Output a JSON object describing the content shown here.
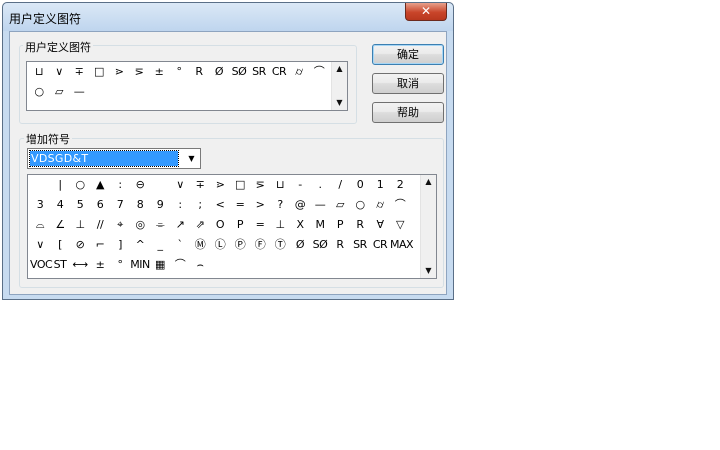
{
  "window": {
    "title": "用户定义图符",
    "close_label": "✕"
  },
  "user_defined_group": {
    "label": "用户定义图符",
    "symbols": [
      "⊔",
      "∨",
      "∓",
      "□",
      "⋗",
      "⋝",
      "±",
      "°",
      "R",
      "Ø",
      "SØ",
      "SR",
      "CR",
      "⌭",
      "⌒",
      "○",
      "▱",
      "—"
    ]
  },
  "buttons": {
    "ok": "确定",
    "cancel": "取消",
    "help": "帮助"
  },
  "add_group": {
    "label": "增加符号",
    "combo_value": "VDSGD&T",
    "symbols": [
      "",
      "|",
      "○",
      "▲",
      ":",
      "⊖",
      "",
      "∨",
      "∓",
      "⋗",
      "□",
      "⋝",
      "⊔",
      "-",
      ".",
      "/",
      "0",
      "1",
      "2",
      "3",
      "4",
      "5",
      "6",
      "7",
      "8",
      "9",
      ":",
      ";",
      "<",
      "=",
      ">",
      "?",
      "@",
      "—",
      "▱",
      "○",
      "⌭",
      "⌒",
      "⌓",
      "∠",
      "⊥",
      "//",
      "⌖",
      "◎",
      "⌯",
      "↗",
      "⇗",
      "O",
      "P",
      "=",
      "⊥",
      "X",
      "M",
      "P",
      "R",
      "∀",
      "▽",
      "∨",
      "[",
      "⊘",
      "⌐",
      "]",
      "^",
      "_",
      "`",
      "Ⓜ",
      "Ⓛ",
      "Ⓟ",
      "Ⓕ",
      "Ⓣ",
      "Ø",
      "SØ",
      "R",
      "SR",
      "CR",
      "MAX",
      "VOC",
      "ST",
      "⟷",
      "±",
      "°",
      "MIN",
      "▦",
      "⌒",
      "⌢"
    ]
  }
}
